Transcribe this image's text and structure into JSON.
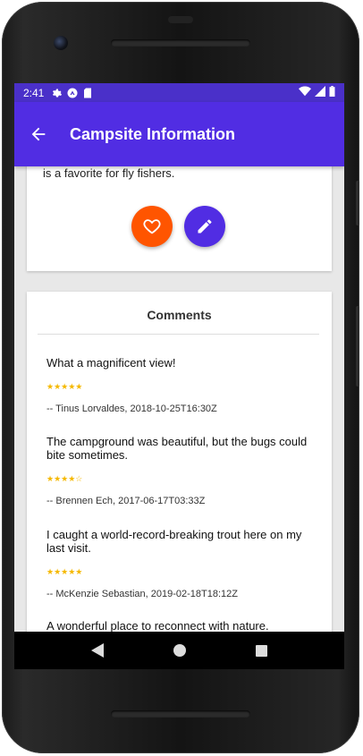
{
  "status_bar": {
    "time": "2:41",
    "left_icons": [
      "gear-icon",
      "android-icon",
      "sd-card-icon"
    ],
    "right_icons": [
      "wifi-icon",
      "signal-icon",
      "battery-icon"
    ]
  },
  "app_bar": {
    "back_icon": "arrow-left-icon",
    "title": "Campsite Information"
  },
  "campsite": {
    "description_tail": "is a favorite for fly fishers.",
    "favorite_icon": "heart-outline-icon",
    "edit_icon": "pencil-icon",
    "colors": {
      "favorite": "#FF5500",
      "edit": "#512DE3",
      "app_bar": "#512DE3"
    }
  },
  "comments": {
    "title": "Comments",
    "items": [
      {
        "text": "What a magnificent view!",
        "stars": "★★★★★",
        "author": "-- Tinus Lorvaldes, 2018-10-25T16:30Z"
      },
      {
        "text": "The campground was beautiful, but the bugs could bite sometimes.",
        "stars": "★★★★☆",
        "author": "-- Brennen Ech, 2017-06-17T03:33Z"
      },
      {
        "text": "I caught a world-record-breaking trout here on my last visit.",
        "stars": "★★★★★",
        "author": "-- McKenzie Sebastian, 2019-02-18T18:12Z"
      },
      {
        "text": "A wonderful place to reconnect with nature.",
        "stars": "",
        "author": ""
      }
    ]
  },
  "nav_bar": {
    "icons": [
      "back-triangle-icon",
      "home-circle-icon",
      "recents-square-icon"
    ]
  }
}
